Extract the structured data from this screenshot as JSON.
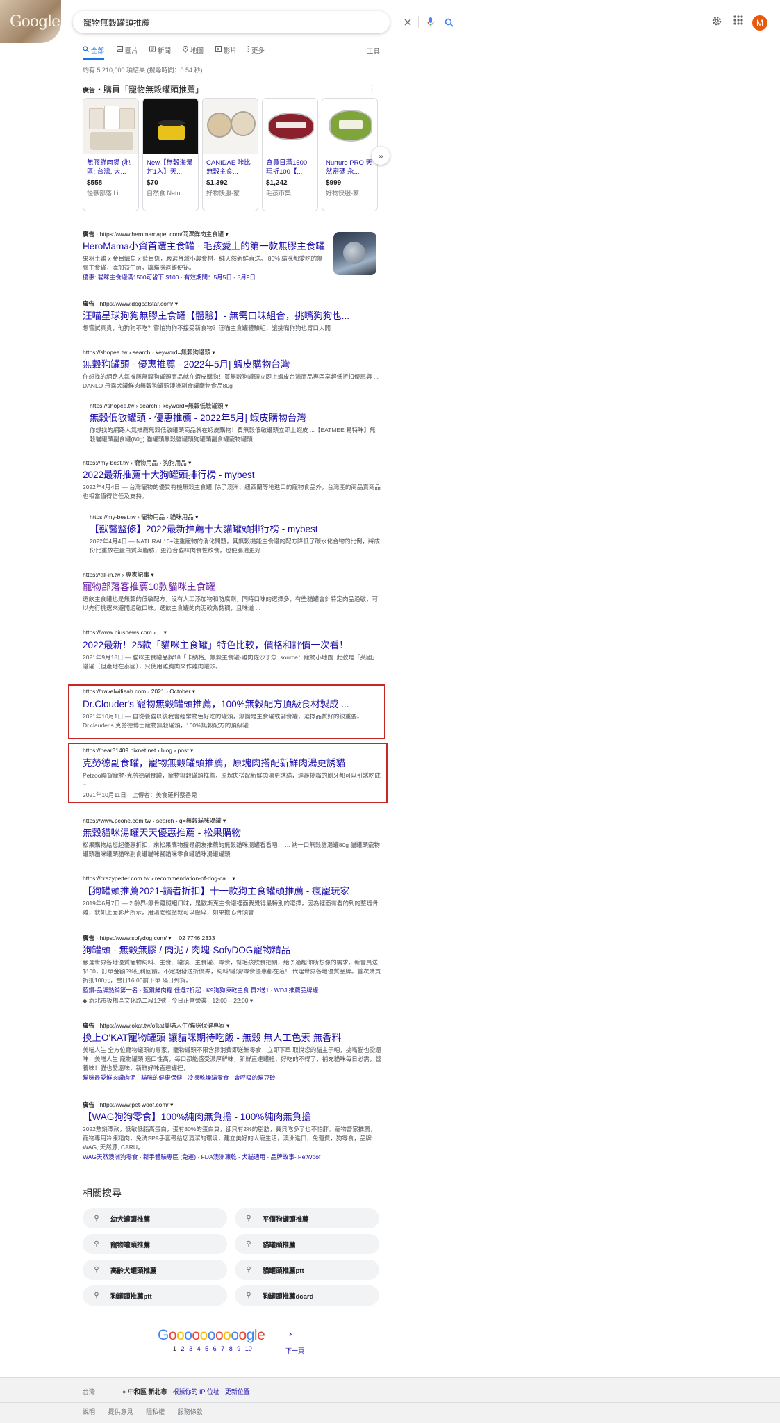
{
  "search": {
    "query": "寵物無穀罐頭推薦"
  },
  "doodle": {
    "text": "Google"
  },
  "header": {
    "avatar_letter": "M"
  },
  "tabs": [
    {
      "label": "全部",
      "icon": "search-icon"
    },
    {
      "label": "圖片",
      "icon": "image-icon"
    },
    {
      "label": "新聞",
      "icon": "news-icon"
    },
    {
      "label": "地圖",
      "icon": "map-pin-icon"
    },
    {
      "label": "影片",
      "icon": "video-icon"
    },
    {
      "label": "更多",
      "icon": "more-vert-icon"
    }
  ],
  "tools_label": "工具",
  "result_stats": "約有 5,210,000 項結果 (搜尋時間：0.54 秒)",
  "shopping": {
    "ad_label": "廣告",
    "title": "・購買「寵物無穀罐頭推薦」",
    "products": [
      {
        "title": "無膠鮮肉煲 (地區: 台灣, 大...",
        "price": "$558",
        "store": "怪獸部落 Lit..."
      },
      {
        "title": "New【無穀海景丼1入】天...",
        "price": "$70",
        "store": "自然食 Natu..."
      },
      {
        "title": "CANIDAE 咔比 無穀主食...",
        "price": "$1,392",
        "store": "好物快服-蒙..."
      },
      {
        "title": "會員日滿1500 現折100【...",
        "price": "$1,242",
        "store": "毛孩市集"
      },
      {
        "title": "Nurture PRO 天然密碼 永...",
        "price": "$999",
        "store": "好物快服-蒙..."
      }
    ]
  },
  "results": [
    {
      "ad": "廣告",
      "url": " · https://www.heromamapet.com/岡澤鮮肉主食罐 ▾",
      "title": "HeroMama小資首選主食罐 - 毛孩愛上的第一款無膠主食罐",
      "desc": "果羽土雞 x 金目鱸魚 x 藍目魚，嚴選台灣小農食材，純天然新鮮直送。 80% 貓咪都愛吃的無膠主食罐，添加益生菌，讓貓咪遠離便祕。",
      "extra": "優惠: 貓咪主食罐滿1500可省下 $100 · 有效期間：5月5日 - 5月9日"
    },
    {
      "ad": "廣告",
      "url": " · https://www.dogcatstar.com/ ▾",
      "title": "汪喵星球狗狗無膠主食罐【體驗】- 無需口味組合，挑嘴狗狗也...",
      "desc": "想嘗試真貴，他狗狗不吃？嘗怕狗狗不接受新食物？汪喵主食罐體驗組，讓挑嘴狗狗也胃口大開"
    },
    {
      "url": "https://shopee.tw › search › keyword=無穀狗罐頭 ▾",
      "title": "無穀狗罐頭 - 優惠推薦 - 2022年5月| 蝦皮購物台灣",
      "desc": "你想找的網路人氣推薦無穀狗罐頭商品就在蝦皮購物！買無穀狗罐頭立即上蝦皮台灣商品專區享超低折扣優惠與 ... DANLO 丹露犬罐鮮肉無穀狗罐頭澳洲副食罐寵物食品80g"
    },
    {
      "url": "https://shopee.tw › search › keyword=無穀低敏罐頭 ▾",
      "title": "無穀低敏罐頭 - 優惠推薦 - 2022年5月| 蝦皮購物台灣",
      "desc": "你想找的網路人氣推薦無穀低敏罐頭商品就在蝦皮購物！買無穀低敏罐頭立即上蝦皮 ...【EATMEE 易特咪】無穀貓罐頭副食罐(80g) 貓罐頭無穀貓罐頭狗罐頭副食罐寵物罐頭"
    },
    {
      "url": "https://my-best.tw › 寵物用品 › 狗狗用品 ▾",
      "title": "2022最新推薦十大狗罐頭排行榜 - mybest",
      "desc": "2022年4月4日 — 台灣寵物的優質有機無穀主食罐. 除了澳洲、紐西蘭等地進口的寵物食品外，台灣產的商品賣商品也相當值得信任及支持。"
    },
    {
      "url": "https://my-best.tw › 寵物用品 › 貓咪用品 ▾",
      "title": "【獸醫監修】2022最新推薦十大貓罐頭排行榜 - mybest",
      "desc": "2022年4月4日 — NATURAL10+注重寵物的消化問題，其無穀機能主食罐的配方降低了碳水化合物的比例，將成份比重放在蛋白質與脂肪，更符合貓咪肉食性飲食，也便腸道更好 ..."
    },
    {
      "url": "https://all-in.tw › 專家記事 ▾",
      "title": "寵物部落客推薦10款貓咪主食罐",
      "desc": "選飲主食罐也是無穀的低敏配方，沒有人工添加物和防腐劑，同時口味的選擇多，有些貓罐會針特定肉品過敏，可以先行挑選來避開過敏口味。選飲主食罐的肉泥較為黏稠，且味道 ..."
    },
    {
      "url": "https://www.niusnews.com › ... ▾",
      "title": "2022最新！25款「貓咪主食罐」特色比較，價格和評價一次看！",
      "desc": "2021年9月18日 — 貓咪主食罐品牌18「卡納格」無穀主食罐-雞肉佐沙丁魚. source：寵物小地圖. 此款是「英國」罐罐（但產地在泰國），只使用雞胸肉來作雞肉罐頭。"
    },
    {
      "url": "https://travelwifieah.com › 2021 › October ▾",
      "title": "Dr.Clouder's 寵物無穀罐頭推薦，100%無穀配方頂級食材製成 ...",
      "desc": "2021年10月1日 — 自從養貓以後我會經常物色好吃的罐頭，無論是主食罐或副食罐，選擇品質好的很重要。Dr.clauder's 克勞德博士寵物無穀罐頭，100%無穀配方的頂級罐 ..."
    },
    {
      "url": "https://bear31409.pixnet.net › blog › post ▾",
      "title": "克勞德副食罐，寵物無穀罐頭推薦，原塊肉搭配新鮮肉湯更誘貓",
      "desc": "Petzoo聯貨寵物-克勞德副食罐，寵物無穀罐頭推薦，原塊肉搭配新鮮肉湯更誘貓，連最挑嘴的刷牙都可以引誘吃成~",
      "meta": "2021年10月11日　上傳者：美食羅料蔡香兒"
    },
    {
      "url": "https://www.pcone.com.tw › search › q=無穀貓咪湯罐 ▾",
      "title": "無穀貓咪湯罐天天優惠推薦 - 松果購物",
      "desc": "松果購物給您超優惠折扣，來松果購物搜尋網友推薦的無穀貓咪湯罐看看吧！ ... 納一口無穀貓湯罐80g 貓罐頭寵物罐頭貓咪罐頭貓咪副食罐貓咪餐貓咪零食罐貓咪湯罐罐頭."
    },
    {
      "url": "https://crazypetter.com.tw › recommendation-of-dog-ca... ▾",
      "title": "【狗罐頭推薦2021-讀者折扣】十一款狗主食罐頭推薦 - 瘋寵玩家",
      "desc": "2019年6月7日 — 2 齡界-無骨雞腿組口味，是歐斯克主食罐裡面我覺得最特別的選擇，因為裡面有看的到的整塊骨雞，就如上面影片所示，用湯匙輕壓就可以壓碎，如果擔心骨頭會 ..."
    },
    {
      "ad": "廣告",
      "url": " · https://www.sofydog.com/ ▾ 　02 7746 2333",
      "title": "狗罐頭 - 無穀無膠 / 肉泥 / 肉塊-SofyDOG寵物精品",
      "desc": "嚴選世界各地優質寵物飼料、主食、罐頭、主食罐、零食，幫毛孩飲食把關，給予適超你所想像的需求。新會員送$100，訂單金額5%紅利回饋。不定期發送折價券，飼料/罐頭/零食優惠都在這！ 代理世界各地優質品牌。首次購買折抵100元，當日16:00前下單 隔日到貨。",
      "extra": "藍鑽-品牌熱銷第一名 · 藍鑽鮮肉糧 任選7折起 · K9狗狗凍乾主食 買2送1 · WDJ 推薦品牌罐",
      "extra2": "新北市板橋區文化路二段12號 - 今日正常營業 · 12:00 – 22:00 ▾"
    },
    {
      "ad": "廣告",
      "url": " · https://www.okat.tw/o'kat美喵人生/貓咪保健專家 ▾",
      "title": "換上O'KAT寵物罐頭 讓貓咪期待吃飯 - 無穀 無人工色素 無香料",
      "desc": "美喵人生 全方位寵物罐頭的專家，寵物罐頭不限含膠消費即送鮮零食！立即下單 取悅您的貓主子吧，挑嘴貓也愛還味！美喵人生 寵物罐頭 適口性高，每口都能感受濃厚鮮味，新鮮直達罐裡，好吃的不得了，補充貓咪每日必需，營養味！貓也愛還味，新鮮好味直達罐裡，",
      "extra": "貓咪最愛鮮肉罐肉泥 · 貓咪的健康保健 · 冷凍乾燥貓零食 · 會呼吸的貓豆砂"
    },
    {
      "ad": "廣告",
      "url": " · https://www.pet-woof.com/ ▾",
      "title": "【WAG狗狗零食】100%純肉無負擔 - 100%純肉無負擔",
      "desc": "2022熱銷澤款，低敏低脂高蛋白，蛋有80%的蛋白質，卻只有2%的脂肪，寶貝吃多了也不怕胖。寵物營家推薦，寵物專用冷凍精肉，免洗SPA手套帶給您清潔的環境，建立美好的人寵生活，澳洲進口，免運費，狗零食，品牌: WAG, 天然源, CARU，",
      "extra": "WAG天然澳洲狗零食 · 新手體驗專區 (免運) · FDA澳洲凍乾 - 犬貓適用 · 品牌故事- PetWoof"
    }
  ],
  "related": {
    "title": "相關搜尋",
    "items": [
      "幼犬罐頭推薦",
      "平價狗罐頭推薦",
      "寵物罐頭推薦",
      "貓罐頭推薦",
      "高齡犬罐頭推薦",
      "貓罐頭推薦ptt",
      "狗罐頭推薦ptt",
      "狗罐頭推薦dcard"
    ]
  },
  "pagination": {
    "logo": "Goooooooooogle",
    "pages": [
      "1",
      "2",
      "3",
      "4",
      "5",
      "6",
      "7",
      "8",
      "9",
      "10"
    ],
    "next": "下一頁"
  },
  "footer": {
    "region": "台灣",
    "location": "中和區 新北市",
    "ip_link": "根據你的 IP 位址",
    "update_link": "更新位置",
    "links": [
      "說明",
      "提供意見",
      "隱私權",
      "服務條款"
    ]
  },
  "colors": {
    "link": "#1a0dab",
    "visited": "#681da8",
    "accent": "#1a73e8",
    "highlight_box": "#c62828"
  }
}
